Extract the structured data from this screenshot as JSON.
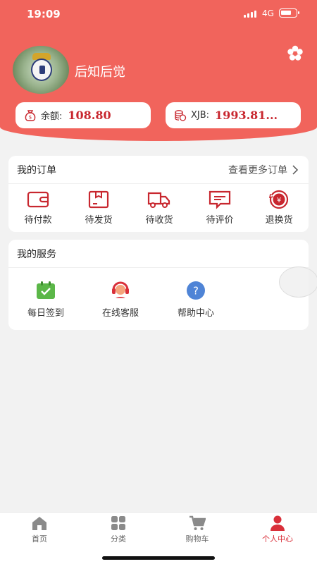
{
  "status_bar": {
    "time": "19:09",
    "network": "4G"
  },
  "profile": {
    "username": "后知后觉",
    "avatar_icon": "real-madrid-crest-avatar"
  },
  "balances": {
    "balance_label": "余额:",
    "balance_value": "108.80",
    "xjb_label": "XJB:",
    "xjb_value": "1993.81..."
  },
  "orders": {
    "title": "我的订单",
    "more_label": "查看更多订单",
    "items": [
      {
        "label": "待付款",
        "icon": "wallet-icon"
      },
      {
        "label": "待发货",
        "icon": "package-icon"
      },
      {
        "label": "待收货",
        "icon": "truck-icon"
      },
      {
        "label": "待评价",
        "icon": "comment-icon"
      },
      {
        "label": "退换货",
        "icon": "refund-icon"
      }
    ]
  },
  "services": {
    "title": "我的服务",
    "items": [
      {
        "label": "每日签到",
        "icon": "calendar-check-icon"
      },
      {
        "label": "在线客服",
        "icon": "headset-icon"
      },
      {
        "label": "帮助中心",
        "icon": "help-icon"
      }
    ]
  },
  "tabbar": {
    "items": [
      {
        "label": "首页",
        "icon": "home-icon"
      },
      {
        "label": "分类",
        "icon": "grid-icon"
      },
      {
        "label": "购物车",
        "icon": "cart-icon"
      },
      {
        "label": "个人中心",
        "icon": "person-icon"
      }
    ],
    "active_index": 3
  },
  "colors": {
    "header": "#f1645c",
    "accent": "#d9303a",
    "value_red": "#c8272f"
  }
}
